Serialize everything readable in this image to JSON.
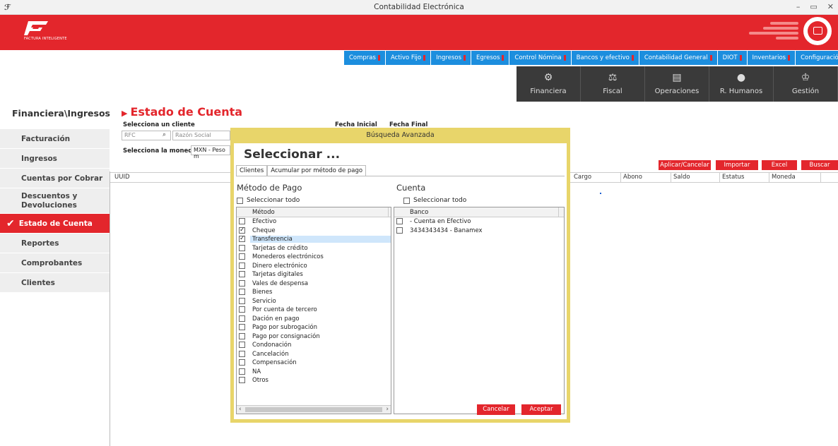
{
  "window": {
    "title": "Contabilidad Electrónica",
    "controls": [
      "–",
      "▭",
      "✕"
    ]
  },
  "header": {
    "logo_text": "FACTURA INTELIGENTE"
  },
  "menu": [
    "Compras",
    "Activo Fijo",
    "Ingresos",
    "Egresos",
    "Control Nómina",
    "Bancos y efectivo",
    "Contabilidad General",
    "DIOT",
    "Inventarios",
    "Configuración"
  ],
  "modules": [
    {
      "label": "Financiera",
      "icon": "financial-icon"
    },
    {
      "label": "Fiscal",
      "icon": "scales-icon"
    },
    {
      "label": "Operaciones",
      "icon": "operations-icon"
    },
    {
      "label": "R. Humanos",
      "icon": "person-icon"
    },
    {
      "label": "Gestión",
      "icon": "org-chart-icon"
    }
  ],
  "breadcrumb": "Financiera\\Ingresos",
  "sidebar": [
    "Facturación",
    "Ingresos",
    "Cuentas por Cobrar",
    "Descuentos y Devoluciones",
    "Estado de Cuenta",
    "Reportes",
    "Comprobantes",
    "Clientes"
  ],
  "sidebar_active": "Estado de Cuenta",
  "main": {
    "title": "Estado de Cuenta",
    "select_client_label": "Selecciona un cliente",
    "rfc_placeholder": "RFC",
    "razon_placeholder": "Razón Social",
    "select_currency_label": "Selecciona la moneda",
    "currency_value": "MXN - Peso m",
    "fecha_inicial": "Fecha Inicial",
    "fecha_final": "Fecha Final",
    "buttons": [
      "Aplicar/Cancelar",
      "Importar",
      "Excel",
      "Buscar"
    ],
    "columns": [
      "UUID",
      "Cargo",
      "Abono",
      "Saldo",
      "Estatus",
      "Moneda"
    ]
  },
  "dialog": {
    "title": "Búsqueda Avanzada",
    "heading": "Seleccionar ...",
    "tabs": [
      "Clientes",
      "Acumular por método de pago"
    ],
    "metodo_title": "Método de Pago",
    "cuenta_title": "Cuenta",
    "select_all": "Seleccionar todo",
    "metodo_header": "Método",
    "banco_header": "Banco",
    "metodos": [
      {
        "name": "Efectivo",
        "checked": false
      },
      {
        "name": "Cheque",
        "checked": true
      },
      {
        "name": "Transferencia",
        "checked": true
      },
      {
        "name": "Tarjetas de crédito",
        "checked": false
      },
      {
        "name": "Monederos electrónicos",
        "checked": false
      },
      {
        "name": "Dinero electrónico",
        "checked": false
      },
      {
        "name": "Tarjetas digitales",
        "checked": false
      },
      {
        "name": "Vales de despensa",
        "checked": false
      },
      {
        "name": "Bienes",
        "checked": false
      },
      {
        "name": "Servicio",
        "checked": false
      },
      {
        "name": "Por cuenta de tercero",
        "checked": false
      },
      {
        "name": "Dación en pago",
        "checked": false
      },
      {
        "name": "Pago por subrogación",
        "checked": false
      },
      {
        "name": "Pago por consignación",
        "checked": false
      },
      {
        "name": "Condonación",
        "checked": false
      },
      {
        "name": "Cancelación",
        "checked": false
      },
      {
        "name": "Compensación",
        "checked": false
      },
      {
        "name": "NA",
        "checked": false
      },
      {
        "name": "Otros",
        "checked": false
      }
    ],
    "bancos": [
      {
        "name": "- Cuenta en Efectivo",
        "checked": false
      },
      {
        "name": "3434343434 - Banamex",
        "checked": false
      }
    ],
    "cancel": "Cancelar",
    "accept": "Aceptar"
  },
  "colors": {
    "brand_red": "#e3262c",
    "menu_blue": "#1c8ede",
    "tile_dark": "#3a3a3a",
    "dialog_frame": "#e8d56a"
  }
}
